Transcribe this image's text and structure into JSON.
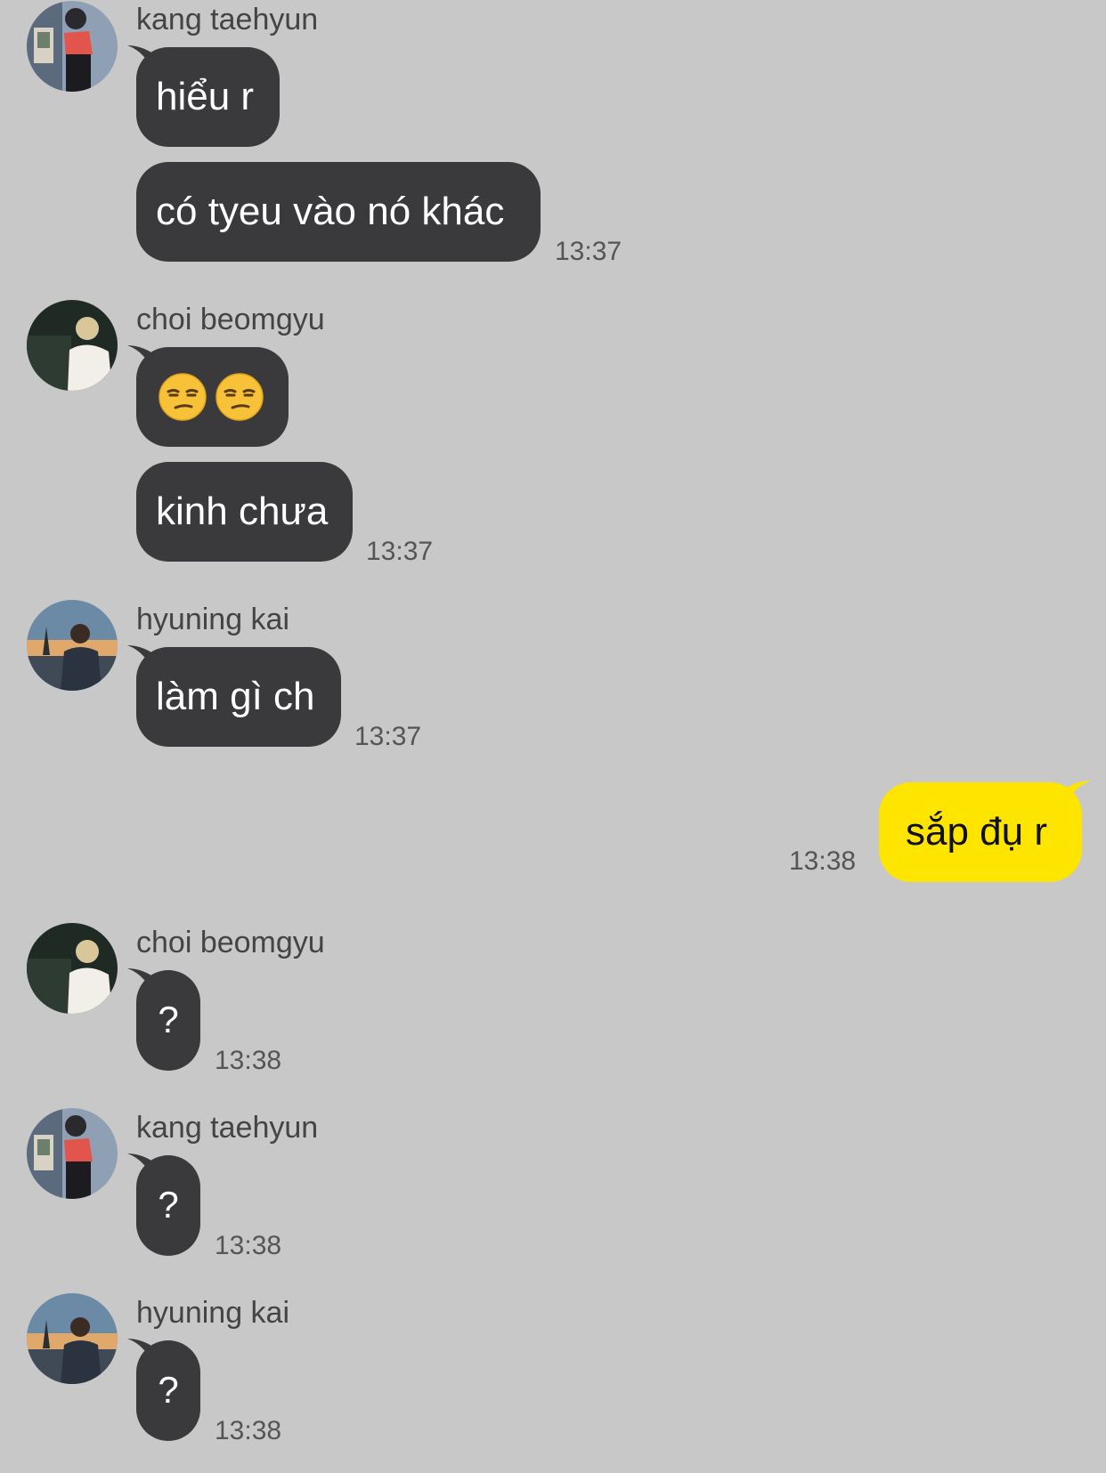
{
  "colors": {
    "background": "#c8c8c8",
    "other_bubble": "#3a3a3c",
    "my_bubble": "#fee500"
  },
  "groups": [
    {
      "sender": "kang taehyun",
      "avatar": "kang-taehyun-avatar",
      "messages": [
        "hiểu r",
        "có tyeu vào nó khác"
      ],
      "time": "13:37"
    },
    {
      "sender": "choi beomgyu",
      "avatar": "choi-beomgyu-avatar",
      "messages": [
        "😒😒",
        "kinh chưa"
      ],
      "time": "13:37"
    },
    {
      "sender": "hyuning kai",
      "avatar": "hyuning-kai-avatar",
      "messages": [
        "làm gì ch"
      ],
      "time": "13:37"
    },
    {
      "sender": "",
      "mine": true,
      "messages": [
        "sắp đụ r"
      ],
      "time": "13:38"
    },
    {
      "sender": "choi beomgyu",
      "avatar": "choi-beomgyu-avatar",
      "messages": [
        "?"
      ],
      "time": "13:38"
    },
    {
      "sender": "kang taehyun",
      "avatar": "kang-taehyun-avatar",
      "messages": [
        "?"
      ],
      "time": "13:38"
    },
    {
      "sender": "hyuning kai",
      "avatar": "hyuning-kai-avatar",
      "messages": [
        "?"
      ],
      "time": "13:38"
    }
  ]
}
